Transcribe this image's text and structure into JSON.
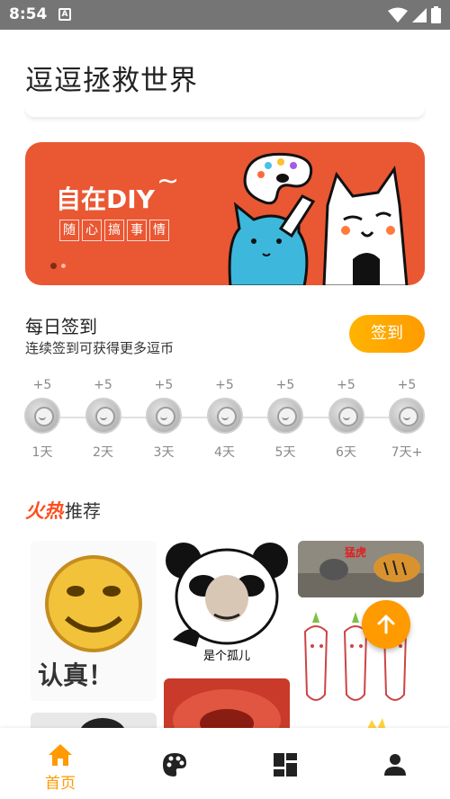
{
  "status_bar": {
    "time": "8:54",
    "notification_letter": "A"
  },
  "app": {
    "title": "逗逗拯救世界"
  },
  "banner": {
    "title": "自在DIY",
    "tilde": "~",
    "tags": [
      "随",
      "心",
      "搞",
      "事",
      "情"
    ],
    "page_count": 2,
    "current_page": 1,
    "background_color": "#ea5733"
  },
  "checkin": {
    "title": "每日签到",
    "subtitle": "连续签到可获得更多逗币",
    "button_label": "签到",
    "days": [
      {
        "bonus": "+5",
        "label": "1天"
      },
      {
        "bonus": "+5",
        "label": "2天"
      },
      {
        "bonus": "+5",
        "label": "3天"
      },
      {
        "bonus": "+5",
        "label": "4天"
      },
      {
        "bonus": "+5",
        "label": "5天"
      },
      {
        "bonus": "+5",
        "label": "6天"
      },
      {
        "bonus": "+5",
        "label": "7天+"
      }
    ]
  },
  "hot": {
    "title_fire": "火热",
    "title_rest": "推荐",
    "items": [
      {
        "icon": "smiley-meme",
        "text": "认真！"
      },
      {
        "icon": "panda-meme",
        "text": "是个孤儿"
      },
      {
        "icon": "tiger-meme",
        "text": "猛虎"
      },
      {
        "icon": "red-meme",
        "text": ""
      },
      {
        "icon": "radish-meme",
        "text": ""
      },
      {
        "icon": "partial-meme",
        "text": ""
      }
    ]
  },
  "nav": {
    "items": [
      {
        "label": "首页",
        "icon": "home-icon",
        "active": true
      },
      {
        "label": "",
        "icon": "palette-icon",
        "active": false
      },
      {
        "label": "",
        "icon": "dashboard-icon",
        "active": false
      },
      {
        "label": "",
        "icon": "person-icon",
        "active": false
      }
    ],
    "accent_color": "#ff9a00"
  }
}
